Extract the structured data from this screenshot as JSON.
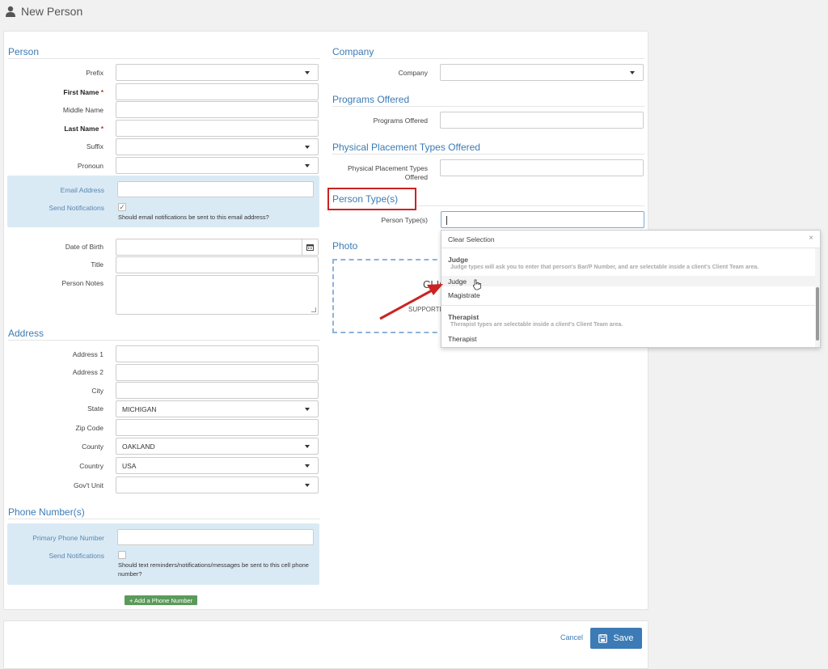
{
  "header": {
    "title": "New Person",
    "icon": "person-icon"
  },
  "person": {
    "title": "Person",
    "prefix_label": "Prefix",
    "prefix_value": "",
    "first_name_label": "First Name",
    "required_mark": "*",
    "middle_name_label": "Middle Name",
    "last_name_label": "Last Name",
    "suffix_label": "Suffix",
    "suffix_value": "",
    "pronoun_label": "Pronoun",
    "pronoun_value": "",
    "email_label": "Email Address",
    "email_value": "",
    "send_notifications_label": "Send Notifications",
    "email_notify_checked": true,
    "email_notify_help": "Should email notifications be sent to this email address?",
    "dob_label": "Date of Birth",
    "title_label": "Title",
    "notes_label": "Person Notes"
  },
  "address": {
    "title": "Address",
    "address1_label": "Address 1",
    "address2_label": "Address 2",
    "city_label": "City",
    "state_label": "State",
    "state_value": "MICHIGAN",
    "zip_label": "Zip Code",
    "county_label": "County",
    "county_value": "OAKLAND",
    "country_label": "Country",
    "country_value": "USA",
    "govt_unit_label": "Gov't Unit",
    "govt_unit_value": ""
  },
  "phones": {
    "title": "Phone Number(s)",
    "primary_label": "Primary Phone Number",
    "primary_value": "",
    "send_notifications_label": "Send Notifications",
    "sms_checked": false,
    "help_line1": "Should text reminders/notifications/messages be sent to this cell phone",
    "help_line2": "number?",
    "add_button": "+ Add a Phone Number"
  },
  "company": {
    "title": "Company",
    "company_label": "Company",
    "company_value": ""
  },
  "programs": {
    "title": "Programs Offered",
    "label": "Programs Offered"
  },
  "placements": {
    "title": "Physical Placement Types Offered",
    "label_line1": "Physical Placement Types",
    "label_line2": "Offered"
  },
  "person_types": {
    "title": "Person Type(s)",
    "label": "Person Type(s)",
    "value": ""
  },
  "photo": {
    "title": "Photo",
    "click_text": "CLIC",
    "supported_text": "SUPPORTE"
  },
  "dropdown": {
    "clear_label": "Clear Selection",
    "close_symbol": "×",
    "groups": [
      {
        "name": "Judge",
        "description": "Judge types will ask you to enter that person's Bar/P Number, and are selectable inside a client's Client Team area.",
        "options": [
          "Judge",
          "Magistrate"
        ]
      },
      {
        "name": "Therapist",
        "description": "Therapist types are selectable inside a client's Client Team area.",
        "options": [
          "Therapist"
        ]
      }
    ]
  },
  "footer": {
    "cancel": "Cancel",
    "save": "Save"
  },
  "colors": {
    "accent": "#3c7bb5",
    "panel": "#daeaf5",
    "highlight": "#cc2222",
    "add_button": "#5b9a5a"
  }
}
